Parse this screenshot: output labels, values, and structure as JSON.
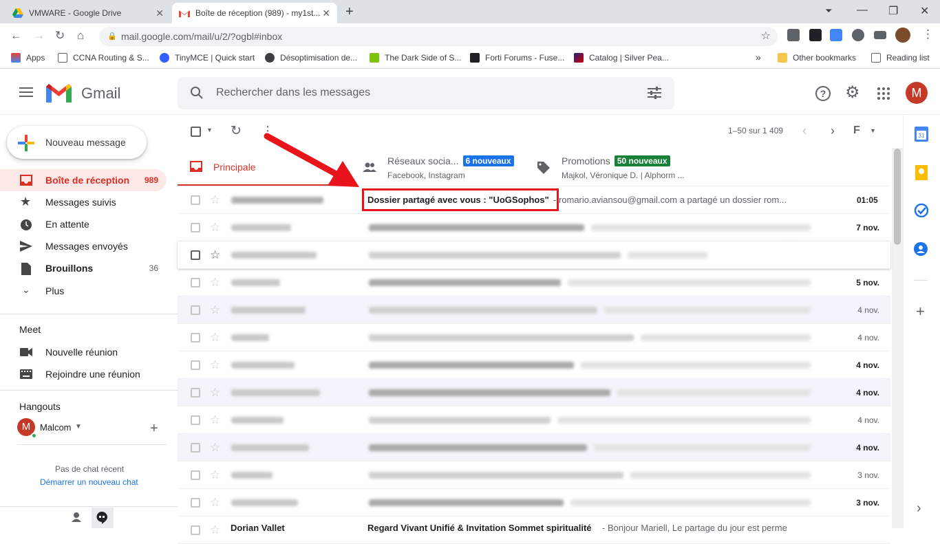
{
  "browser": {
    "tabs": [
      {
        "title": "VMWARE - Google Drive"
      },
      {
        "title": "Boîte de réception (989) - my1st..."
      }
    ],
    "url": "mail.google.com/mail/u/2/?ogbl#inbox",
    "bookmarks": [
      {
        "label": "Apps"
      },
      {
        "label": "CCNA Routing & S..."
      },
      {
        "label": "TinyMCE | Quick start"
      },
      {
        "label": "Désoptimisation de..."
      },
      {
        "label": "The Dark Side of S..."
      },
      {
        "label": "Forti Forums - Fuse..."
      },
      {
        "label": "Catalog | Silver Pea..."
      }
    ],
    "other_bookmarks": "Other bookmarks",
    "reading_list": "Reading list"
  },
  "gmail": {
    "logo": "Gmail",
    "search_placeholder": "Rechercher dans les messages",
    "avatar": "M",
    "compose": "Nouveau message",
    "nav": [
      {
        "label": "Boîte de réception",
        "count": "989",
        "active": true,
        "icon": "inbox-icon"
      },
      {
        "label": "Messages suivis",
        "count": "",
        "icon": "star-icon"
      },
      {
        "label": "En attente",
        "count": "",
        "icon": "clock-icon"
      },
      {
        "label": "Messages envoyés",
        "count": "",
        "icon": "send-icon"
      },
      {
        "label": "Brouillons",
        "count": "36",
        "bold": true,
        "icon": "draft-icon"
      },
      {
        "label": "Plus",
        "count": "",
        "icon": "chevron-down-icon"
      }
    ],
    "meet": {
      "title": "Meet",
      "items": [
        "Nouvelle réunion",
        "Rejoindre une réunion"
      ]
    },
    "hangouts": {
      "title": "Hangouts",
      "user": "Malcom",
      "user_initial": "M",
      "no_chat": "Pas de chat récent",
      "start_chat": "Démarrer un nouveau chat"
    },
    "pagination": "1–50 sur 1 409",
    "category_tabs": [
      {
        "label": "Principale"
      },
      {
        "label": "Réseaux socia...",
        "badge": "6 nouveaux",
        "sub": "Facebook, Instagram"
      },
      {
        "label": "Promotions",
        "badge": "50 nouveaux",
        "sub": "Majkol, Véronique D. | Alphorm ..."
      }
    ],
    "highlighted_email": {
      "subject": "Dossier partagé avec vous : \"UoGSophos\"",
      "snippet": " - romario.aviansou@gmail.com a partagé un dossier rom...",
      "date": "01:05"
    },
    "dates": [
      "7 nov.",
      "",
      "5 nov.",
      "4 nov.",
      "4 nov.",
      "4 nov.",
      "4 nov.",
      "4 nov.",
      "4 nov.",
      "3 nov.",
      "3 nov."
    ],
    "last_row": {
      "sender": "Dorian Vallet",
      "subject": "Regard Vivant Unifié & Invitation Sommet spiritualité",
      "snippet": " - Bonjour Mariell, Le partage du jour est perme"
    },
    "colors": {
      "red": "#d93025",
      "blue_badge": "#1a73e8",
      "green_badge": "#188038",
      "annotation": "#e8141c"
    }
  }
}
